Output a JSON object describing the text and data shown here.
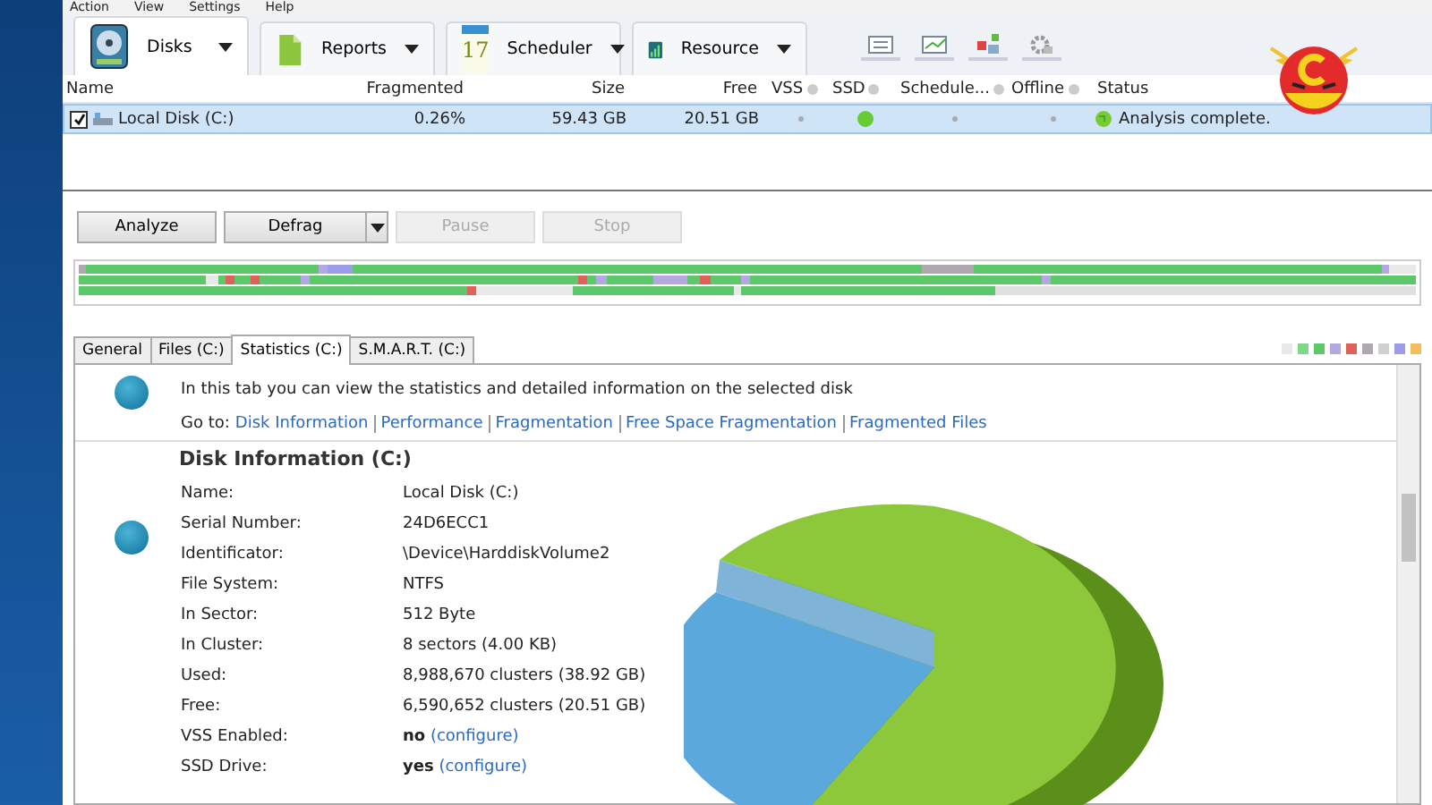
{
  "menu": [
    "Action",
    "View",
    "Settings",
    "Help"
  ],
  "toolbar_tabs": [
    {
      "label": "Disks",
      "selected": true
    },
    {
      "label": "Reports",
      "selected": false
    },
    {
      "label": "Scheduler",
      "selected": false
    },
    {
      "label": "Resource",
      "selected": false
    }
  ],
  "calendar_day": "17",
  "disk_table": {
    "columns": [
      {
        "label": "Name",
        "info": false
      },
      {
        "label": "Fragmented",
        "info": false
      },
      {
        "label": "Size",
        "info": false
      },
      {
        "label": "Free",
        "info": false
      },
      {
        "label": "VSS",
        "info": true
      },
      {
        "label": "SSD",
        "info": true
      },
      {
        "label": "Schedule...",
        "info": true
      },
      {
        "label": "Offline",
        "info": true
      },
      {
        "label": "Status",
        "info": false
      }
    ],
    "rows": [
      {
        "checked": true,
        "selected": true,
        "name": "Local Disk (C:)",
        "fragmented": "0.26%",
        "size": "59.43 GB",
        "free": "20.51 GB",
        "vss": false,
        "ssd": true,
        "scheduled": false,
        "offline": false,
        "status": "Analysis complete."
      }
    ]
  },
  "actions": [
    {
      "label": "Analyze",
      "disabled": false,
      "dropdown": false
    },
    {
      "label": "Defrag",
      "disabled": false,
      "dropdown": true
    },
    {
      "label": "Pause",
      "disabled": true,
      "dropdown": false
    },
    {
      "label": "Stop",
      "disabled": true,
      "dropdown": false
    }
  ],
  "legend": [
    {
      "color": "#e8e8e8"
    },
    {
      "color": "#7fd88a"
    },
    {
      "color": "#5cc86a"
    },
    {
      "color": "#b4a8e0"
    },
    {
      "color": "#e0605a"
    },
    {
      "color": "#b0a8b0"
    },
    {
      "color": "#d0d0d0"
    },
    {
      "color": "#9c9ce8"
    },
    {
      "color": "#f0c060"
    }
  ],
  "info_tabs": [
    {
      "label": "General",
      "selected": false
    },
    {
      "label": "Files (C:)",
      "selected": false
    },
    {
      "label": "Statistics (C:)",
      "selected": true
    },
    {
      "label": "S.M.A.R.T. (C:)",
      "selected": false
    }
  ],
  "intro": "In this tab you can view the statistics and detailed information on the selected disk",
  "goto_label": "Go to:",
  "goto_links": [
    "Disk Information",
    "Performance",
    "Fragmentation",
    "Free Space Fragmentation",
    "Fragmented Files"
  ],
  "section_title": "Disk Information (C:)",
  "fields": [
    {
      "label": "Name:",
      "value": "Local Disk (C:)"
    },
    {
      "label": "Serial Number:",
      "value": "24D6ECC1"
    },
    {
      "label": "Identificator:",
      "value": "\\Device\\HarddiskVolume2"
    },
    {
      "label": "File System:",
      "value": "NTFS"
    },
    {
      "label": "In Sector:",
      "value": "512 Byte"
    },
    {
      "label": "In Cluster:",
      "value": "8 sectors (4.00 KB)"
    },
    {
      "label": "Used:",
      "value": "8,988,670 clusters (38.92 GB)"
    },
    {
      "label": "Free:",
      "value": "6,590,652 clusters (20.51 GB)"
    },
    {
      "label": "VSS Enabled:",
      "value": "no",
      "link": "(configure)"
    },
    {
      "label": "SSD Drive:",
      "value": "yes",
      "link": "(configure)"
    }
  ]
}
